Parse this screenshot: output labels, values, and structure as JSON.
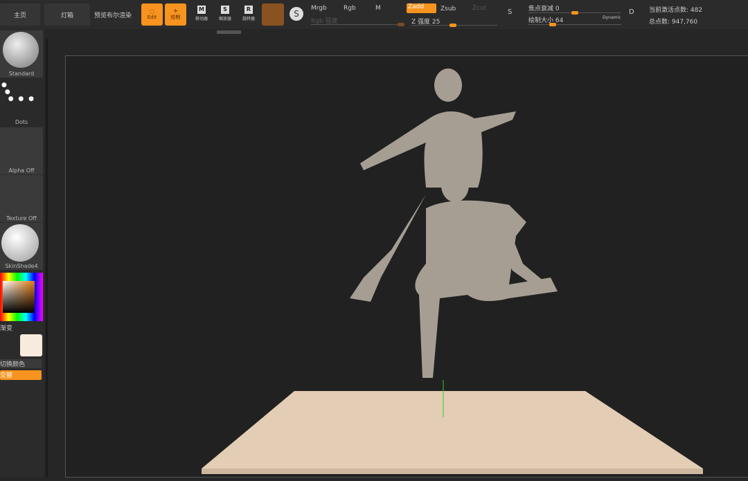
{
  "toolbar": {
    "home": "主页",
    "lightbox": "灯箱",
    "bpr": "预览布尔渲染",
    "edit": "Edit",
    "draw": "绘制",
    "move": "移动器",
    "scale": "缩放器",
    "rotate": "旋转器",
    "move_key": "M",
    "scale_key": "S",
    "rotate_key": "R"
  },
  "modes": {
    "mrgb": "Mrgb",
    "rgb": "Rgb",
    "m": "M",
    "zadd": "Zadd",
    "zsub": "Zsub",
    "zcut": "Zcut",
    "rgb_intensity": "Rgb 强度",
    "z_intensity": "Z 强度 25",
    "focal": "焦点衰减 0",
    "draw_size": "绘制大小 64",
    "dynamic": "Dynamic",
    "s": "S",
    "d": "D",
    "active_points": "当前激活点数: 482",
    "total_points": "总点数: 947,760"
  },
  "values": {
    "z_intensity": 25,
    "focal_shift": 0,
    "draw_size": 64
  },
  "sidebar": {
    "brush": "Standard",
    "stroke": "Dots",
    "alpha": "Alpha Off",
    "texture": "Texture Off",
    "material": "SkinShade4",
    "gradient": "渐变",
    "switch_color": "切换颜色",
    "alternate": "交替"
  },
  "colors": {
    "accent": "#f7931e",
    "main_color": "#f8ebde",
    "floor": "#e3cdb5",
    "model": "#a69e93"
  }
}
